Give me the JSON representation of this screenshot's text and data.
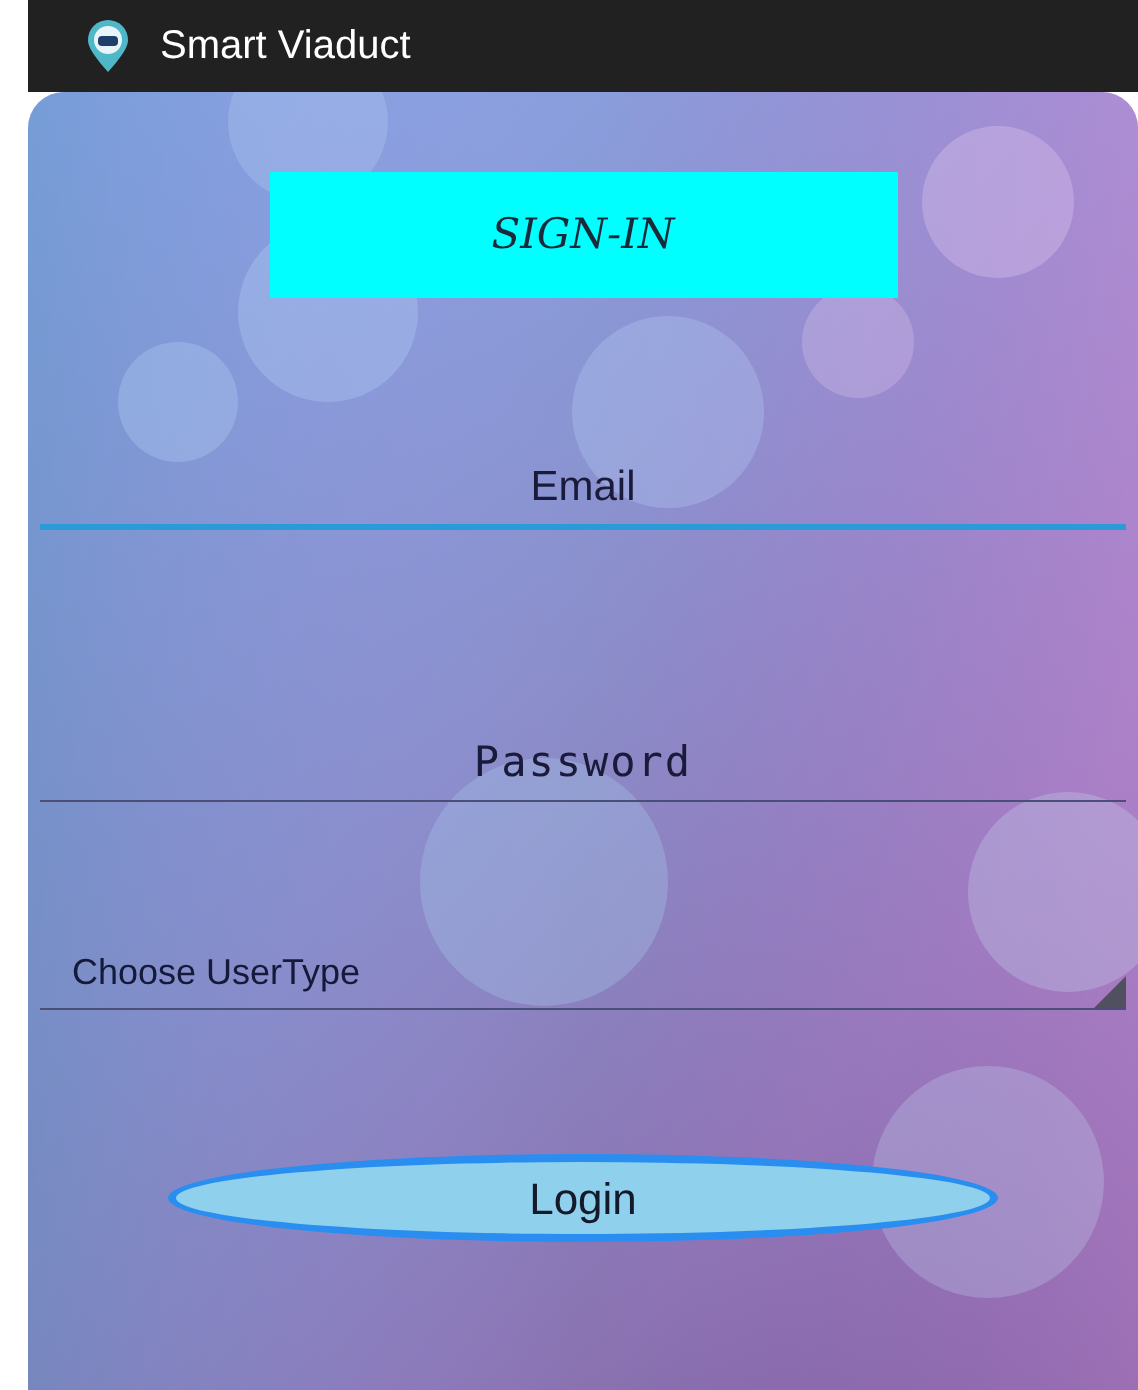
{
  "app_bar": {
    "title": "Smart Viaduct"
  },
  "heading": "SIGN-IN",
  "fields": [
    {
      "kind": "email",
      "placeholder": "Email",
      "focused": true
    },
    {
      "kind": "password",
      "placeholder": "Password",
      "focused": false
    }
  ],
  "user_type": {
    "label": "Choose UserType"
  },
  "login_button": "Login"
}
